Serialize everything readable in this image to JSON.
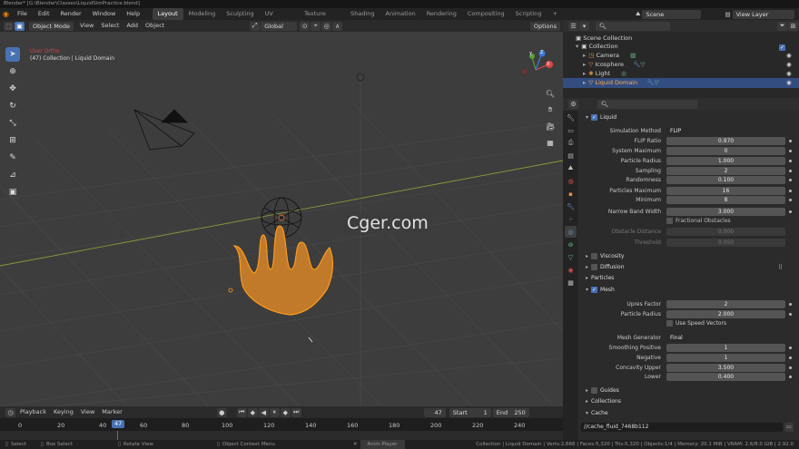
{
  "window": {
    "title": "Blender* [G:\\Blender\\Classes\\LiquidSimPractice.blend]"
  },
  "topbar": {
    "menus": [
      "File",
      "Edit",
      "Render",
      "Window",
      "Help"
    ],
    "workspaces": [
      "Layout",
      "Modeling",
      "Sculpting",
      "UV Editing",
      "Texture Paint",
      "Shading",
      "Animation",
      "Rendering",
      "Compositing",
      "Scripting"
    ],
    "add_tab": "+",
    "scene": "Scene",
    "view_layer": "View Layer"
  },
  "viewport": {
    "mode": "Object Mode",
    "menus": [
      "View",
      "Select",
      "Add",
      "Object"
    ],
    "transform_orientation": "Global",
    "options": "Options",
    "view_label": "User Ortho",
    "context_label": "(47) Collection | Liquid Domain",
    "gizmo_axes": {
      "x": "X",
      "y": "Y",
      "z": "Z"
    }
  },
  "outliner": {
    "rows": [
      {
        "label": "Scene Collection",
        "selected": false
      },
      {
        "label": "Collection",
        "selected": false
      },
      {
        "label": "Camera",
        "selected": false
      },
      {
        "label": "Icosphere",
        "selected": false
      },
      {
        "label": "Light",
        "selected": false
      },
      {
        "label": "Liquid Domain",
        "selected": true
      }
    ]
  },
  "properties": {
    "panel_liquid": "Liquid",
    "rows": [
      {
        "label": "Simulation Method",
        "value": "FLIP"
      },
      {
        "label": "FLIP Ratio",
        "value": "0.970"
      },
      {
        "label": "System Maximum",
        "value": "0"
      },
      {
        "label": "Particle Radius",
        "value": "1.000"
      },
      {
        "label": "Sampling",
        "value": "2"
      },
      {
        "label": "Randomness",
        "value": "0.100"
      },
      {
        "label": "Particles Maximum",
        "value": "16"
      },
      {
        "label": "Minimum",
        "value": "8"
      },
      {
        "label": "Narrow Band Width",
        "value": "3.000"
      }
    ],
    "fractional_obstacles": "Fractional Obstacles",
    "obstacle_distance": {
      "label": "Obstacle Distance",
      "value": "0.000"
    },
    "threshold": {
      "label": "Threshold",
      "value": "0.050"
    },
    "sections": {
      "viscosity": "Viscosity",
      "diffusion": "Diffusion",
      "particles": "Particles",
      "mesh": "Mesh"
    },
    "mesh_rows": [
      {
        "label": "Upres Factor",
        "value": "2"
      },
      {
        "label": "Particle Radius",
        "value": "2.000"
      }
    ],
    "use_speed_vectors": "Use Speed Vectors",
    "mesh_generator": {
      "label": "Mesh Generator",
      "value": "Final"
    },
    "mesh_rows2": [
      {
        "label": "Smoothing Positive",
        "value": "1"
      },
      {
        "label": "Negative",
        "value": "1"
      },
      {
        "label": "Concavity Upper",
        "value": "3.500"
      },
      {
        "label": "Lower",
        "value": "0.400"
      }
    ],
    "tail_sections": {
      "guides": "Guides",
      "collections": "Collections",
      "cache": "Cache"
    },
    "cache_path": "//cache_fluid_7468b112"
  },
  "timeline": {
    "menus": [
      "Playback",
      "Keying",
      "View",
      "Marker"
    ],
    "current_frame": "47",
    "start_label": "Start",
    "start": "1",
    "end_label": "End",
    "end": "250",
    "ticks": [
      "0",
      "20",
      "40",
      "60",
      "80",
      "100",
      "120",
      "140",
      "160",
      "180",
      "200",
      "220",
      "240"
    ]
  },
  "statusbar": {
    "items": [
      "Select",
      "Box Select",
      "Rotate View",
      "Object Context Menu",
      "Anim Player"
    ],
    "info": "Collection | Liquid Domain | Verts:2,666 | Faces:5,320 | Tris:5,320 | Objects:1/4 | Memory: 20.1 MiB | VRAM: 2.6/8.0 GiB | 2.92.0"
  },
  "watermark": "Cger.com",
  "colors": {
    "accent": "#4772b3",
    "selection_orange": "#ff9a1a",
    "viewport_bg": "#3d3d3d"
  }
}
